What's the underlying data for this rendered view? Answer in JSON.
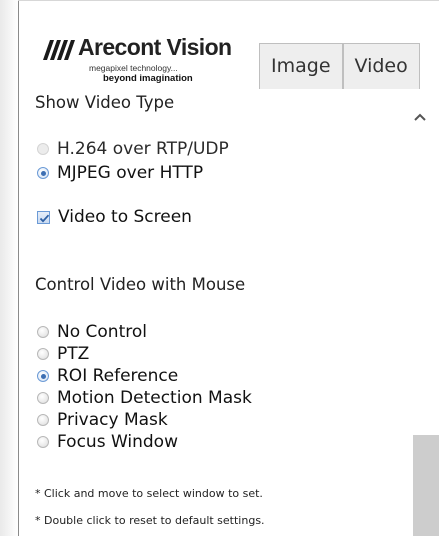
{
  "logo": {
    "brand": "Arecont Vision",
    "tagline1": "megapixel technology...",
    "tagline2": "beyond imagination"
  },
  "tabs": [
    {
      "label": "Image"
    },
    {
      "label": "Video"
    }
  ],
  "show_video_type": {
    "title": "Show Video Type",
    "options": [
      {
        "label": "H.264 over RTP/UDP",
        "state": "disabled"
      },
      {
        "label": "MJPEG over HTTP",
        "state": "selected"
      }
    ],
    "video_to_screen": {
      "label": "Video to Screen",
      "checked": true
    }
  },
  "control_video": {
    "title": "Control Video with Mouse",
    "options": [
      {
        "label": "No Control",
        "selected": false
      },
      {
        "label": "PTZ",
        "selected": false
      },
      {
        "label": "ROI Reference",
        "selected": true
      },
      {
        "label": "Motion Detection Mask",
        "selected": false
      },
      {
        "label": "Privacy Mask",
        "selected": false
      },
      {
        "label": "Focus Window",
        "selected": false
      }
    ]
  },
  "notes": [
    "* Click and move to select window to set.",
    "* Double click to reset to default settings."
  ],
  "colors": {
    "accent": "#3d6fb3",
    "scroll_thumb": "#cdcdcd",
    "tab_bg": "#eeeeee"
  }
}
